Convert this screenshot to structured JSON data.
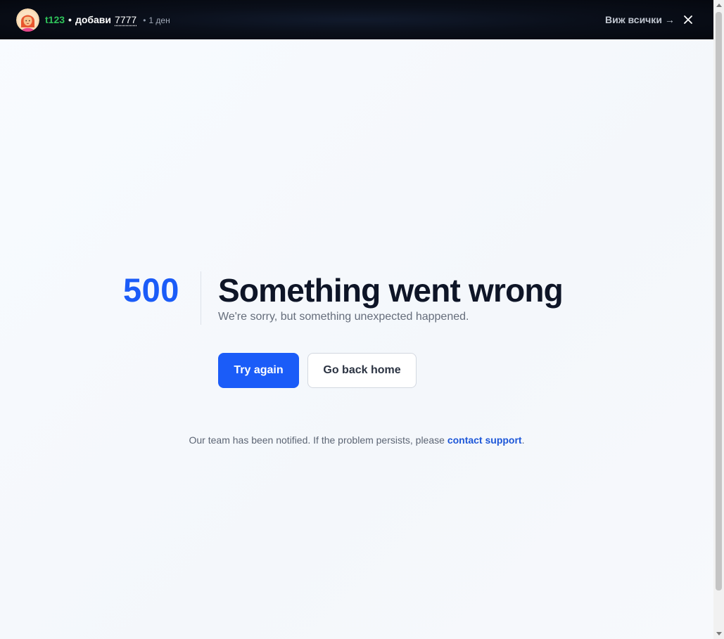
{
  "notification": {
    "user": "t123",
    "separator": "•",
    "action": "добави",
    "item": "7777",
    "dot": "•",
    "time": "1 ден",
    "view_all": "Виж всички →",
    "avatar_icon": "female-avatar-icon",
    "close_icon": "close-icon"
  },
  "error": {
    "code": "500",
    "title": "Something went wrong",
    "subtitle": "We're sorry, but something unexpected happened.",
    "primary_button": "Try again",
    "secondary_button": "Go back home",
    "footer_prefix": "Our team has been notified. If the problem persists, please ",
    "footer_link": "contact support",
    "footer_suffix": "."
  },
  "colors": {
    "accent": "#1b5cf8",
    "user_green": "#2fc35a",
    "title": "#0e1527",
    "link": "#1d57d8"
  }
}
